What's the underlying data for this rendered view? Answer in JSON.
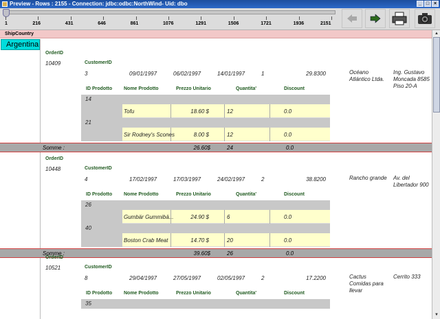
{
  "window": {
    "title": "Preview - Rows : 2155 - Connection: jdbc:odbc:NorthWind- Uid: dbo"
  },
  "ruler": {
    "ticks": [
      "1",
      "216",
      "431",
      "646",
      "861",
      "1076",
      "1291",
      "1506",
      "1721",
      "1936",
      "2151"
    ]
  },
  "toolbar": {
    "back_icon": "arrow-left-icon",
    "forward_icon": "arrow-right-icon",
    "print_icon": "printer-icon",
    "camera_icon": "camera-icon"
  },
  "report": {
    "group_label": "ShipCountry",
    "group_value": "Argentina",
    "order_label": "OrderID",
    "customer_label": "CustomerID",
    "detail_headers": {
      "id": "ID Prodotto",
      "name": "Nome Prodotto",
      "price": "Prezzo Unitario",
      "qty": "Quantita'",
      "disc": "Discount"
    },
    "sum_label": "Somme :",
    "orders": [
      {
        "id": "10409",
        "emp": "3",
        "d1": "09/01/1997",
        "d2": "06/02/1997",
        "d3": "14/01/1997",
        "via": "1",
        "freight": "29.8300",
        "ship": "Océano Atlántico Ltda.",
        "addr": "Ing. Gustavo Moncada 8585 Piso 20-A",
        "items": [
          {
            "pid": "14",
            "name": "Tofu",
            "price": "18.60 $",
            "qty": "12",
            "disc": "0.0"
          },
          {
            "pid": "21",
            "name": "Sir Rodney's Scones",
            "price": "8.00 $",
            "qty": "12",
            "disc": "0.0"
          }
        ],
        "sum_price": "26.60$",
        "sum_qty": "24",
        "sum_disc": "0.0"
      },
      {
        "id": "10448",
        "emp": "4",
        "d1": "17/02/1997",
        "d2": "17/03/1997",
        "d3": "24/02/1997",
        "via": "2",
        "freight": "38.8200",
        "ship": "Rancho grande",
        "addr": "Av. del Libertador 900",
        "items": [
          {
            "pid": "26",
            "name": "Gumbär Gummibä...",
            "price": "24.90 $",
            "qty": "6",
            "disc": "0.0"
          },
          {
            "pid": "40",
            "name": "Boston Crab Meat",
            "price": "14.70 $",
            "qty": "20",
            "disc": "0.0"
          }
        ],
        "sum_price": "39.60$",
        "sum_qty": "26",
        "sum_disc": "0.0"
      },
      {
        "id": "10521",
        "emp": "8",
        "d1": "29/04/1997",
        "d2": "27/05/1997",
        "d3": "02/05/1997",
        "via": "2",
        "freight": "17.2200",
        "ship": "Cactus Comidas para llevar",
        "addr": "Cerrito 333",
        "items": [
          {
            "pid": "35"
          }
        ]
      }
    ]
  }
}
